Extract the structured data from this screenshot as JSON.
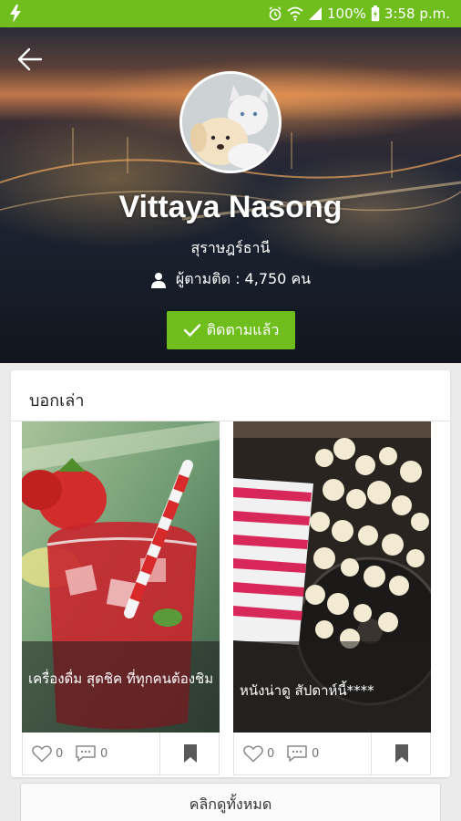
{
  "status_bar": {
    "battery": "100%",
    "time": "3:58 p.m."
  },
  "profile": {
    "name": "Vittaya Nasong",
    "location": "สุราษฎร์ธานี",
    "followers": "ผู้ตามติด : 4,750 คน",
    "follow_button": "ติดตามแล้ว"
  },
  "stories": {
    "section_title": "บอกเล่า",
    "items": [
      {
        "caption": "เครื่องดื่ม สุดชิค ที่ทุกคนต้องชิม",
        "likes": "0",
        "comments": "0"
      },
      {
        "caption": "หนังน่าดู สัปดาห์นี้****",
        "likes": "0",
        "comments": "0"
      }
    ],
    "view_all": "คลิกดูทั้งหมด"
  },
  "colors": {
    "brand_green": "#6fbe1e"
  }
}
